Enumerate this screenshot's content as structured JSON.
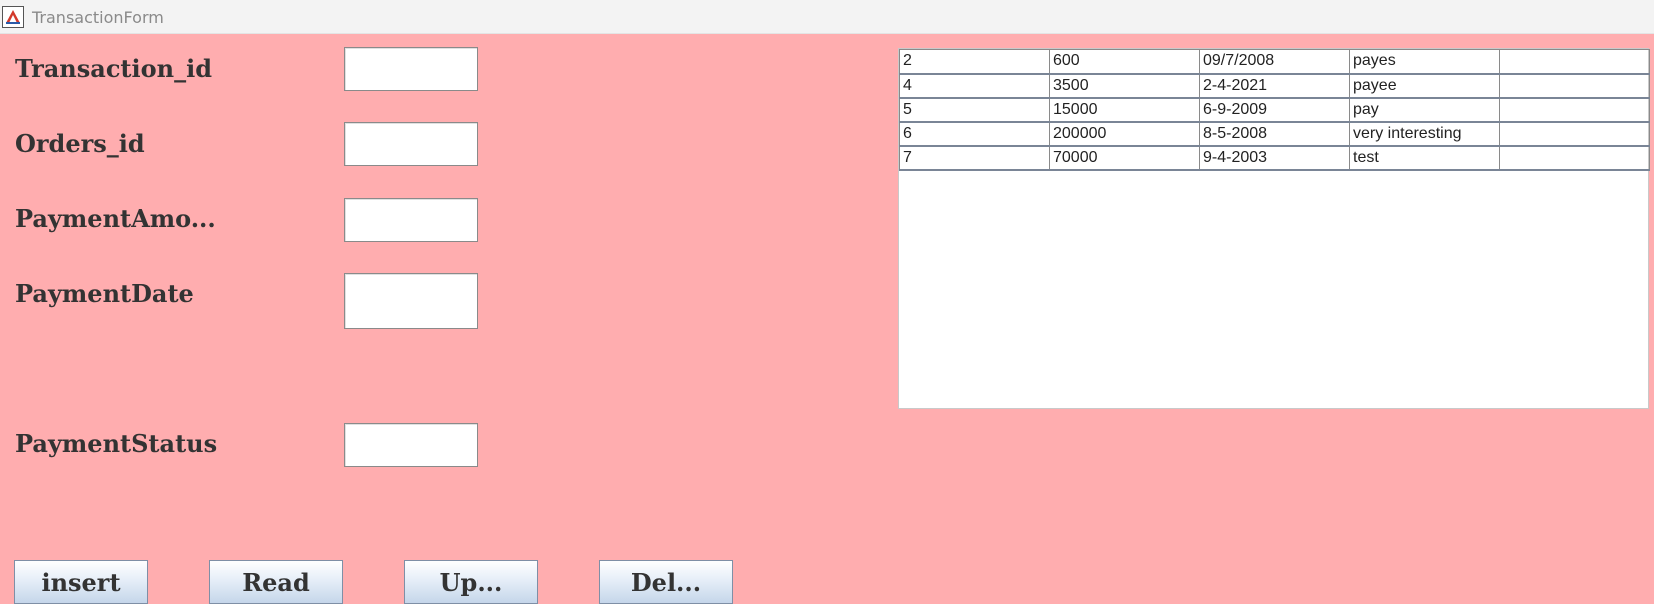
{
  "window": {
    "title": "TransactionForm",
    "icon": "java-app-icon"
  },
  "colors": {
    "background": "#ffadaf",
    "button_gradient_top": "#ffffff",
    "button_gradient_bottom": "#c5d6ea"
  },
  "form": {
    "fields": [
      {
        "label": "Transaction_id",
        "value": ""
      },
      {
        "label": "Orders_id",
        "value": ""
      },
      {
        "label": "PaymentAmo...",
        "value": ""
      },
      {
        "label": "PaymentDate",
        "value": ""
      },
      {
        "label": "PaymentStatus",
        "value": ""
      }
    ]
  },
  "table": {
    "rows": [
      [
        "2",
        "600",
        "09/7/2008",
        "payes",
        ""
      ],
      [
        "4",
        "3500",
        "2-4-2021",
        "payee",
        ""
      ],
      [
        "5",
        "15000",
        "6-9-2009",
        "pay",
        ""
      ],
      [
        "6",
        "200000",
        "8-5-2008",
        "very interesting",
        ""
      ],
      [
        "7",
        "70000",
        "9-4-2003",
        "test",
        ""
      ]
    ]
  },
  "buttons": {
    "insert": "insert",
    "read": "Read",
    "update": "Up...",
    "delete": "Del..."
  }
}
